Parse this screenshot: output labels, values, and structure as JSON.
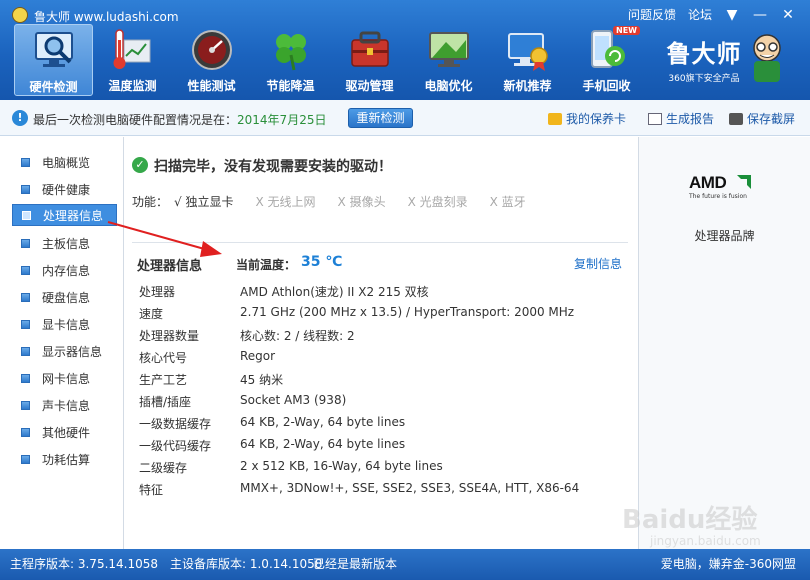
{
  "window": {
    "title": "鲁大师 www.ludashi.com",
    "links": [
      "问题反馈",
      "论坛"
    ],
    "buttons": {
      "menu": "▼",
      "minimize": "—",
      "close": "✕"
    }
  },
  "toolbar": {
    "items": [
      {
        "label": "硬件检测",
        "icon": "monitor-magnifier-icon",
        "active": true
      },
      {
        "label": "温度监测",
        "icon": "thermometer-icon",
        "active": false
      },
      {
        "label": "性能测试",
        "icon": "speedometer-icon",
        "active": false
      },
      {
        "label": "节能降温",
        "icon": "clover-icon",
        "active": false
      },
      {
        "label": "驱动管理",
        "icon": "driver-toolbox-icon",
        "active": false
      },
      {
        "label": "电脑优化",
        "icon": "optimize-screen-icon",
        "active": false
      },
      {
        "label": "新机推荐",
        "icon": "pc-badge-icon",
        "active": false
      },
      {
        "label": "手机回收",
        "icon": "phone-recycle-icon",
        "active": false,
        "badge": "NEW"
      }
    ],
    "brand_name": "鲁大师",
    "brand_slogan": "360旗下安全产品"
  },
  "infobar": {
    "text_prefix": "最后一次检测电脑硬件配置情况是在：",
    "date": "2014年7月25日",
    "recheck_label": "重新检测",
    "vip_label": "我的保养卡",
    "report_label": "生成报告",
    "screenshot_label": "保存截屏"
  },
  "sidebar": {
    "items": [
      {
        "label": "电脑概览",
        "active": false
      },
      {
        "label": "硬件健康",
        "active": false
      },
      {
        "label": "处理器信息",
        "active": true
      },
      {
        "label": "主板信息",
        "active": false
      },
      {
        "label": "内存信息",
        "active": false
      },
      {
        "label": "硬盘信息",
        "active": false
      },
      {
        "label": "显卡信息",
        "active": false
      },
      {
        "label": "显示器信息",
        "active": false
      },
      {
        "label": "网卡信息",
        "active": false
      },
      {
        "label": "声卡信息",
        "active": false
      },
      {
        "label": "其他硬件",
        "active": false
      },
      {
        "label": "功耗估算",
        "active": false
      }
    ]
  },
  "main": {
    "scan_message": "扫描完毕，没有发现需要安装的驱动！",
    "functions_label": "功能：",
    "functions": [
      {
        "label": "√ 独立显卡",
        "enabled": true
      },
      {
        "label": "X 无线上网",
        "enabled": false
      },
      {
        "label": "X 摄像头",
        "enabled": false
      },
      {
        "label": "X 光盘刻录",
        "enabled": false
      },
      {
        "label": "X 蓝牙",
        "enabled": false
      }
    ],
    "section_title": "处理器信息",
    "temp_label": "当前温度：",
    "temp_value": "35 ℃",
    "copy_label": "复制信息",
    "specs": [
      {
        "key": "处理器",
        "value": "AMD Athlon(速龙) II X2 215 双核"
      },
      {
        "key": "速度",
        "value": "2.71 GHz (200 MHz x 13.5) / HyperTransport: 2000 MHz"
      },
      {
        "key": "处理器数量",
        "value": "核心数: 2 / 线程数: 2"
      },
      {
        "key": "核心代号",
        "value": "Regor"
      },
      {
        "key": "生产工艺",
        "value": "45 纳米"
      },
      {
        "key": "插槽/插座",
        "value": "Socket AM3 (938)"
      },
      {
        "key": "一级数据缓存",
        "value": "64 KB, 2-Way, 64 byte lines"
      },
      {
        "key": "一级代码缓存",
        "value": "64 KB, 2-Way, 64 byte lines"
      },
      {
        "key": "二级缓存",
        "value": "2 x 512 KB, 16-Way, 64 byte lines"
      },
      {
        "key": "特征",
        "value": "MMX+, 3DNow!+, SSE, SSE2, SSE3, SSE4A, HTT, X86-64"
      }
    ]
  },
  "right_panel": {
    "logo_text": "AMD",
    "logo_tagline": "The future is fusion",
    "caption": "处理器品牌"
  },
  "statusbar": {
    "program_version": "主程序版本: 3.75.14.1058",
    "db_version": "主设备库版本: 1.0.14.1058",
    "update_status": "已经是最新版本",
    "right_text": "爱电脑，嫌弃金-360网盟"
  },
  "watermark": {
    "text": "Baidu经验",
    "sub": "jingyan.baidu.com"
  },
  "colors": {
    "header": "#1b63be",
    "accent": "#3f8ee0",
    "ok": "#35a84a",
    "temp": "#1d80d6",
    "annotation": "#e02020"
  }
}
